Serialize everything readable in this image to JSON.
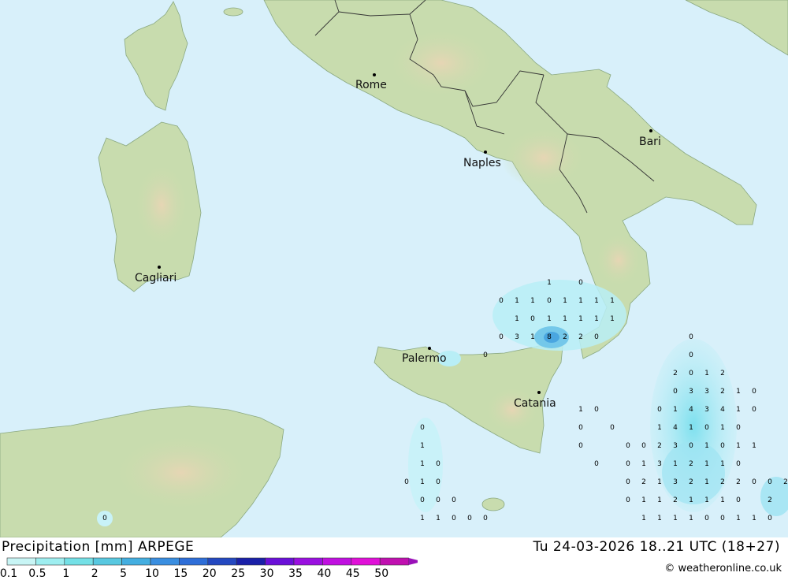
{
  "footer": {
    "title": "Precipitation [mm] ARPEGE",
    "datetime": "Tu 24-03-2026 18..21 UTC (18+27)",
    "credit": "© weatheronline.co.uk"
  },
  "cities": [
    {
      "name": "Rome"
    },
    {
      "name": "Naples"
    },
    {
      "name": "Bari"
    },
    {
      "name": "Cagliari"
    },
    {
      "name": "Palermo"
    },
    {
      "name": "Catania"
    }
  ],
  "legend": {
    "labels": [
      "0.1",
      "0.5",
      "1",
      "2",
      "5",
      "10",
      "15",
      "20",
      "25",
      "30",
      "35",
      "40",
      "45",
      "50"
    ],
    "colors": [
      "#c8f5f5",
      "#9eeef0",
      "#74e0e6",
      "#58c8e0",
      "#44aee0",
      "#3a8ee0",
      "#2e6ed8",
      "#2448c0",
      "#1a20a8",
      "#6a10d8",
      "#9a10e0",
      "#c010e0",
      "#e010d8",
      "#c010b0"
    ]
  },
  "colors": {
    "sea": "#d8f0fa",
    "land": "#c8dcae",
    "border": "#333333"
  },
  "precip_values": [
    "1",
    "0",
    "0",
    "1",
    "1",
    "0",
    "1",
    "1",
    "1",
    "1",
    "1",
    "0",
    "1",
    "1",
    "1",
    "1",
    "1",
    "0",
    "3",
    "1",
    "8",
    "2",
    "2",
    "0",
    "0",
    "0",
    "0",
    "2",
    "0",
    "1",
    "2",
    "0",
    "0",
    "3",
    "3",
    "2",
    "1",
    "0",
    "1",
    "0",
    "0",
    "1",
    "4",
    "3",
    "4",
    "1",
    "0",
    "0",
    "0",
    "1",
    "4",
    "1",
    "0",
    "1",
    "0",
    "1",
    "0",
    "0",
    "0",
    "2",
    "3",
    "0",
    "1",
    "0",
    "1",
    "1",
    "1",
    "0",
    "0",
    "0",
    "1",
    "3",
    "1",
    "2",
    "1",
    "1",
    "0",
    "0",
    "1",
    "0",
    "0",
    "2",
    "1",
    "3",
    "2",
    "1",
    "2",
    "2",
    "0",
    "0",
    "2",
    "0",
    "0",
    "0",
    "0",
    "1",
    "1",
    "2",
    "1",
    "1",
    "1",
    "0",
    "2",
    "0",
    "1",
    "1",
    "0",
    "0",
    "0",
    "1",
    "1",
    "1",
    "1",
    "0",
    "0",
    "1",
    "1",
    "0"
  ]
}
